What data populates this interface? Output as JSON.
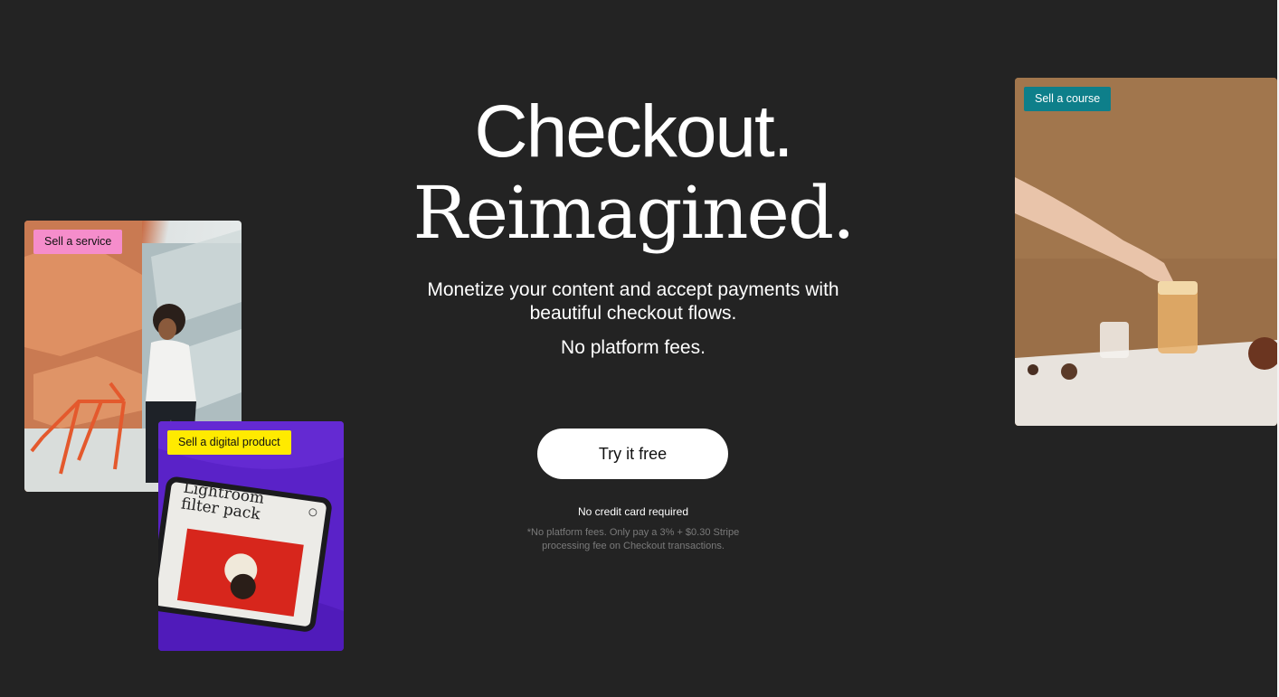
{
  "hero": {
    "headline_line1": "Checkout.",
    "headline_line2": "Reimagined.",
    "subhead": "Monetize your content and accept payments with beautiful checkout flows.",
    "no_fees": "No platform fees.",
    "cta_label": "Try it free",
    "no_credit_card": "No credit card required",
    "fine_print": "*No platform fees. Only pay a 3% + $0.30 Stripe processing fee on Checkout transactions."
  },
  "cards": {
    "service": {
      "tag": "Sell a service",
      "tag_color": "#f58dcb"
    },
    "digital": {
      "tag": "Sell a digital product",
      "tag_color": "#ffea00",
      "screen_title": "Lightroom filter pack"
    },
    "course": {
      "tag": "Sell a course",
      "tag_color": "#0e7f8a"
    }
  },
  "colors": {
    "background": "#232323",
    "cta_background": "#ffffff",
    "fine_print": "#7a7a7a"
  }
}
